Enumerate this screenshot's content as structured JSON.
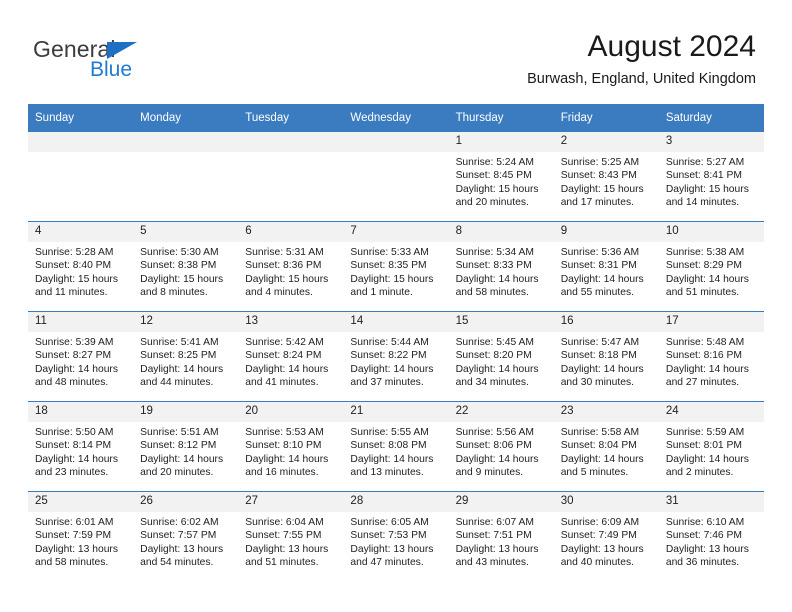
{
  "brand": {
    "name_part1": "General",
    "name_part2": "Blue",
    "flag_icon": "triangle-flag-icon"
  },
  "header": {
    "title": "August 2024",
    "location": "Burwash, England, United Kingdom"
  },
  "colors": {
    "header_blue": "#3b7cc0",
    "brand_blue": "#1f7ad4",
    "daynum_bg": "#f2f2f2"
  },
  "weekday_headers": [
    "Sunday",
    "Monday",
    "Tuesday",
    "Wednesday",
    "Thursday",
    "Friday",
    "Saturday"
  ],
  "labels": {
    "sunrise_prefix": "Sunrise:",
    "sunset_prefix": "Sunset:",
    "daylight_prefix": "Daylight:"
  },
  "weeks": [
    [
      {
        "day": "",
        "blank": true
      },
      {
        "day": "",
        "blank": true
      },
      {
        "day": "",
        "blank": true
      },
      {
        "day": "",
        "blank": true
      },
      {
        "day": "1",
        "sunrise": "Sunrise: 5:24 AM",
        "sunset": "Sunset: 8:45 PM",
        "daylight_l1": "Daylight: 15 hours",
        "daylight_l2": "and 20 minutes."
      },
      {
        "day": "2",
        "sunrise": "Sunrise: 5:25 AM",
        "sunset": "Sunset: 8:43 PM",
        "daylight_l1": "Daylight: 15 hours",
        "daylight_l2": "and 17 minutes."
      },
      {
        "day": "3",
        "sunrise": "Sunrise: 5:27 AM",
        "sunset": "Sunset: 8:41 PM",
        "daylight_l1": "Daylight: 15 hours",
        "daylight_l2": "and 14 minutes."
      }
    ],
    [
      {
        "day": "4",
        "sunrise": "Sunrise: 5:28 AM",
        "sunset": "Sunset: 8:40 PM",
        "daylight_l1": "Daylight: 15 hours",
        "daylight_l2": "and 11 minutes."
      },
      {
        "day": "5",
        "sunrise": "Sunrise: 5:30 AM",
        "sunset": "Sunset: 8:38 PM",
        "daylight_l1": "Daylight: 15 hours",
        "daylight_l2": "and 8 minutes."
      },
      {
        "day": "6",
        "sunrise": "Sunrise: 5:31 AM",
        "sunset": "Sunset: 8:36 PM",
        "daylight_l1": "Daylight: 15 hours",
        "daylight_l2": "and 4 minutes."
      },
      {
        "day": "7",
        "sunrise": "Sunrise: 5:33 AM",
        "sunset": "Sunset: 8:35 PM",
        "daylight_l1": "Daylight: 15 hours",
        "daylight_l2": "and 1 minute."
      },
      {
        "day": "8",
        "sunrise": "Sunrise: 5:34 AM",
        "sunset": "Sunset: 8:33 PM",
        "daylight_l1": "Daylight: 14 hours",
        "daylight_l2": "and 58 minutes."
      },
      {
        "day": "9",
        "sunrise": "Sunrise: 5:36 AM",
        "sunset": "Sunset: 8:31 PM",
        "daylight_l1": "Daylight: 14 hours",
        "daylight_l2": "and 55 minutes."
      },
      {
        "day": "10",
        "sunrise": "Sunrise: 5:38 AM",
        "sunset": "Sunset: 8:29 PM",
        "daylight_l1": "Daylight: 14 hours",
        "daylight_l2": "and 51 minutes."
      }
    ],
    [
      {
        "day": "11",
        "sunrise": "Sunrise: 5:39 AM",
        "sunset": "Sunset: 8:27 PM",
        "daylight_l1": "Daylight: 14 hours",
        "daylight_l2": "and 48 minutes."
      },
      {
        "day": "12",
        "sunrise": "Sunrise: 5:41 AM",
        "sunset": "Sunset: 8:25 PM",
        "daylight_l1": "Daylight: 14 hours",
        "daylight_l2": "and 44 minutes."
      },
      {
        "day": "13",
        "sunrise": "Sunrise: 5:42 AM",
        "sunset": "Sunset: 8:24 PM",
        "daylight_l1": "Daylight: 14 hours",
        "daylight_l2": "and 41 minutes."
      },
      {
        "day": "14",
        "sunrise": "Sunrise: 5:44 AM",
        "sunset": "Sunset: 8:22 PM",
        "daylight_l1": "Daylight: 14 hours",
        "daylight_l2": "and 37 minutes."
      },
      {
        "day": "15",
        "sunrise": "Sunrise: 5:45 AM",
        "sunset": "Sunset: 8:20 PM",
        "daylight_l1": "Daylight: 14 hours",
        "daylight_l2": "and 34 minutes."
      },
      {
        "day": "16",
        "sunrise": "Sunrise: 5:47 AM",
        "sunset": "Sunset: 8:18 PM",
        "daylight_l1": "Daylight: 14 hours",
        "daylight_l2": "and 30 minutes."
      },
      {
        "day": "17",
        "sunrise": "Sunrise: 5:48 AM",
        "sunset": "Sunset: 8:16 PM",
        "daylight_l1": "Daylight: 14 hours",
        "daylight_l2": "and 27 minutes."
      }
    ],
    [
      {
        "day": "18",
        "sunrise": "Sunrise: 5:50 AM",
        "sunset": "Sunset: 8:14 PM",
        "daylight_l1": "Daylight: 14 hours",
        "daylight_l2": "and 23 minutes."
      },
      {
        "day": "19",
        "sunrise": "Sunrise: 5:51 AM",
        "sunset": "Sunset: 8:12 PM",
        "daylight_l1": "Daylight: 14 hours",
        "daylight_l2": "and 20 minutes."
      },
      {
        "day": "20",
        "sunrise": "Sunrise: 5:53 AM",
        "sunset": "Sunset: 8:10 PM",
        "daylight_l1": "Daylight: 14 hours",
        "daylight_l2": "and 16 minutes."
      },
      {
        "day": "21",
        "sunrise": "Sunrise: 5:55 AM",
        "sunset": "Sunset: 8:08 PM",
        "daylight_l1": "Daylight: 14 hours",
        "daylight_l2": "and 13 minutes."
      },
      {
        "day": "22",
        "sunrise": "Sunrise: 5:56 AM",
        "sunset": "Sunset: 8:06 PM",
        "daylight_l1": "Daylight: 14 hours",
        "daylight_l2": "and 9 minutes."
      },
      {
        "day": "23",
        "sunrise": "Sunrise: 5:58 AM",
        "sunset": "Sunset: 8:04 PM",
        "daylight_l1": "Daylight: 14 hours",
        "daylight_l2": "and 5 minutes."
      },
      {
        "day": "24",
        "sunrise": "Sunrise: 5:59 AM",
        "sunset": "Sunset: 8:01 PM",
        "daylight_l1": "Daylight: 14 hours",
        "daylight_l2": "and 2 minutes."
      }
    ],
    [
      {
        "day": "25",
        "sunrise": "Sunrise: 6:01 AM",
        "sunset": "Sunset: 7:59 PM",
        "daylight_l1": "Daylight: 13 hours",
        "daylight_l2": "and 58 minutes."
      },
      {
        "day": "26",
        "sunrise": "Sunrise: 6:02 AM",
        "sunset": "Sunset: 7:57 PM",
        "daylight_l1": "Daylight: 13 hours",
        "daylight_l2": "and 54 minutes."
      },
      {
        "day": "27",
        "sunrise": "Sunrise: 6:04 AM",
        "sunset": "Sunset: 7:55 PM",
        "daylight_l1": "Daylight: 13 hours",
        "daylight_l2": "and 51 minutes."
      },
      {
        "day": "28",
        "sunrise": "Sunrise: 6:05 AM",
        "sunset": "Sunset: 7:53 PM",
        "daylight_l1": "Daylight: 13 hours",
        "daylight_l2": "and 47 minutes."
      },
      {
        "day": "29",
        "sunrise": "Sunrise: 6:07 AM",
        "sunset": "Sunset: 7:51 PM",
        "daylight_l1": "Daylight: 13 hours",
        "daylight_l2": "and 43 minutes."
      },
      {
        "day": "30",
        "sunrise": "Sunrise: 6:09 AM",
        "sunset": "Sunset: 7:49 PM",
        "daylight_l1": "Daylight: 13 hours",
        "daylight_l2": "and 40 minutes."
      },
      {
        "day": "31",
        "sunrise": "Sunrise: 6:10 AM",
        "sunset": "Sunset: 7:46 PM",
        "daylight_l1": "Daylight: 13 hours",
        "daylight_l2": "and 36 minutes."
      }
    ]
  ]
}
